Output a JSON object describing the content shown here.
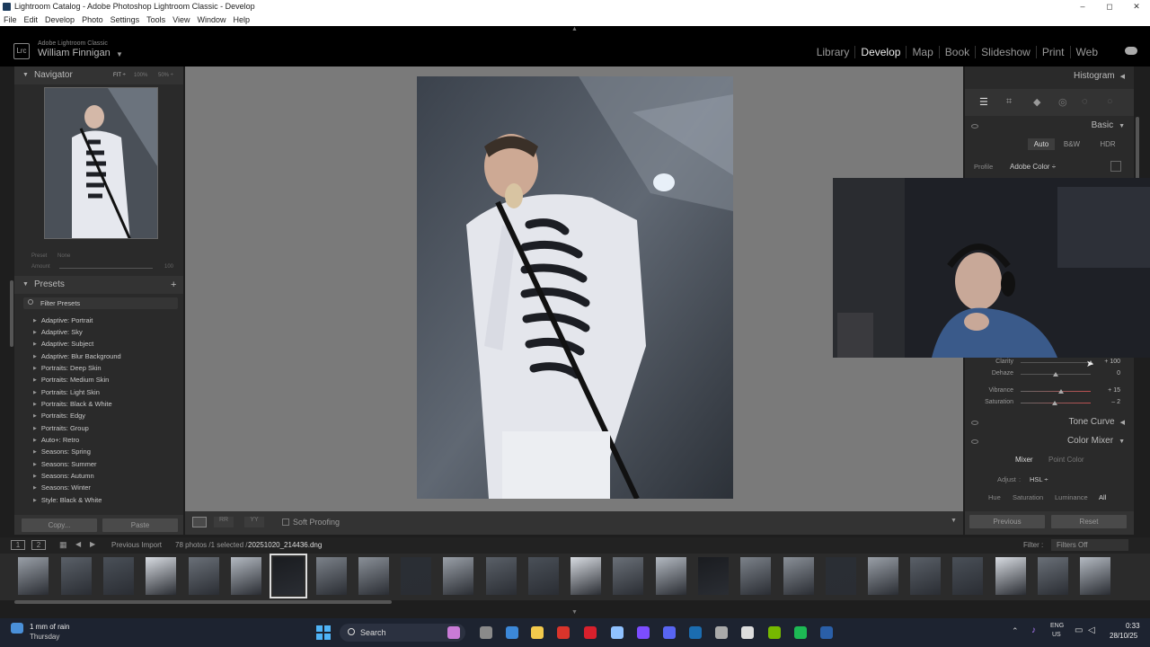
{
  "window": {
    "title": "Lightroom Catalog - Adobe Photoshop Lightroom Classic - Develop",
    "controls": [
      "–",
      "◻",
      "✕"
    ]
  },
  "menu": [
    "File",
    "Edit",
    "Develop",
    "Photo",
    "Settings",
    "Tools",
    "View",
    "Window",
    "Help"
  ],
  "identity": {
    "badge": "Lrc",
    "product": "Adobe Lightroom Classic",
    "user": "William Finnigan"
  },
  "modules": [
    "Library",
    "Develop",
    "Map",
    "Book",
    "Slideshow",
    "Print",
    "Web"
  ],
  "active_module": "Develop",
  "navigator": {
    "title": "Navigator",
    "zoom_options": [
      "FIT ÷",
      "100%",
      "50% ÷"
    ]
  },
  "preset_amount": {
    "preset_label": "Preset",
    "preset_value": "None",
    "amount_label": "Amount",
    "amount_value": "100"
  },
  "presets": {
    "title": "Presets",
    "filter_label": "Filter Presets",
    "items": [
      "Adaptive: Portrait",
      "Adaptive: Sky",
      "Adaptive: Subject",
      "Adaptive: Blur Background",
      "Portraits: Deep Skin",
      "Portraits: Medium Skin",
      "Portraits: Light Skin",
      "Portraits: Black & White",
      "Portraits: Edgy",
      "Portraits: Group",
      "Auto+: Retro",
      "Seasons: Spring",
      "Seasons: Summer",
      "Seasons: Autumn",
      "Seasons: Winter",
      "Style: Black & White"
    ]
  },
  "left_buttons": {
    "copy": "Copy...",
    "paste": "Paste"
  },
  "toolbar": {
    "soft_proofing": "Soft Proofing"
  },
  "right": {
    "histogram": "Histogram",
    "basic": "Basic",
    "treatment": [
      "Auto",
      "B&W",
      "HDR"
    ],
    "profile_label": "Profile",
    "profile_value": "Adobe Color ÷",
    "sliders": [
      {
        "label": "Clarity",
        "value": "+ 100",
        "level": 1.0
      },
      {
        "label": "Dehaze",
        "value": "0",
        "level": 0.5
      },
      {
        "label": "Vibrance",
        "value": "+ 15",
        "level": 0.575
      },
      {
        "label": "Saturation",
        "value": "– 2",
        "level": 0.49
      }
    ],
    "tone_curve": "Tone Curve",
    "color_mixer": "Color Mixer",
    "mixer_tabs": [
      "Mixer",
      "Point Color"
    ],
    "adjust_label": "Adjust",
    "adjust_value": "HSL ÷",
    "hsl_tabs": [
      "Hue",
      "Saturation",
      "Luminance",
      "All"
    ],
    "previous": "Previous",
    "reset": "Reset"
  },
  "filmbar": {
    "pages": [
      "1",
      "2"
    ],
    "source": "Previous Import",
    "count": "78 photos /1 selected /",
    "filename": "20251020_214436.dng",
    "filter_label": "Filter :",
    "filter_value": "Filters Off"
  },
  "taskbar": {
    "weather_temp": "1 mm of rain",
    "weather_day": "Thursday",
    "search": "Search",
    "lang1": "ENG",
    "lang2": "US",
    "time": "0:33",
    "date": "28/10/25"
  },
  "colors": {
    "panel": "#2a2a2a",
    "center_bg": "#7a7a7a",
    "active_module": "#eeeeee",
    "taskbar": "#1d2330"
  }
}
